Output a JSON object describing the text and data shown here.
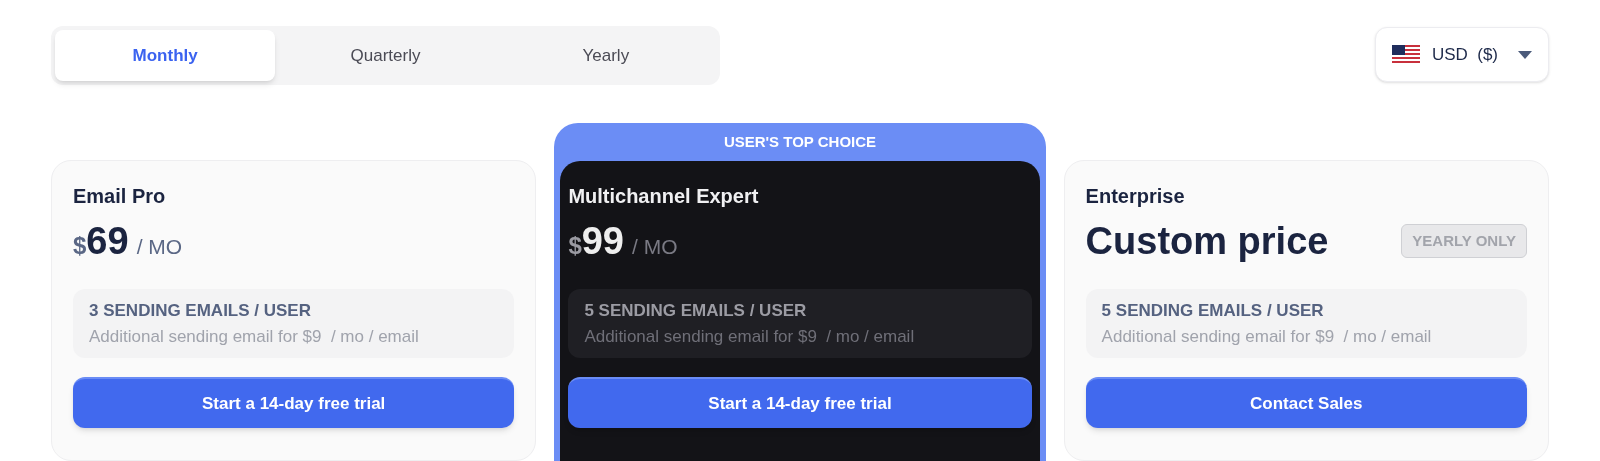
{
  "billing_tabs": [
    {
      "label": "Monthly",
      "selected": true
    },
    {
      "label": "Quarterly",
      "selected": false
    },
    {
      "label": "Yearly",
      "selected": false
    }
  ],
  "currency": {
    "label": "USD  ($)"
  },
  "plans": [
    {
      "name": "Email Pro",
      "featured": false,
      "price": {
        "kind": "amount",
        "currency": "$",
        "amount": "69",
        "period": "/ MO"
      },
      "feature": {
        "title": "3 SENDING EMAILS / USER",
        "detail": "Additional sending email for $9  / mo / email"
      },
      "button": "Start a 14-day free trial"
    },
    {
      "name": "Multichannel Expert",
      "featured": true,
      "ribbon": "USER'S TOP CHOICE",
      "price": {
        "kind": "amount",
        "currency": "$",
        "amount": "99",
        "period": "/ MO"
      },
      "feature": {
        "title": "5 SENDING EMAILS / USER",
        "detail": "Additional sending email for $9  / mo / email"
      },
      "button": "Start a 14-day free trial"
    },
    {
      "name": "Enterprise",
      "featured": false,
      "price": {
        "kind": "custom",
        "text": "Custom price"
      },
      "badge": "YEARLY ONLY",
      "feature": {
        "title": "5 SENDING EMAILS / USER",
        "detail": "Additional sending email for $9  / mo / email"
      },
      "button": "Contact Sales"
    }
  ]
}
